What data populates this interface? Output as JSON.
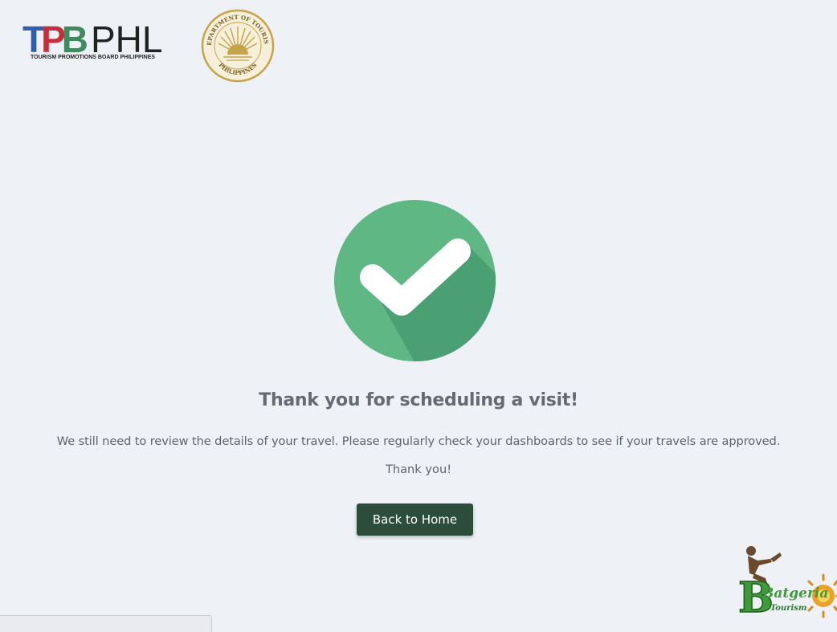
{
  "header": {
    "tpb_logo": {
      "mark_letters": [
        "T",
        "P",
        "B"
      ],
      "phl": "PHL",
      "subtitle": "TOURISM PROMOTIONS BOARD PHILIPPINES",
      "colors": {
        "t": "#2e5fb0",
        "p": "#c4303a",
        "b": "#3f8a5e"
      }
    },
    "dot_seal": {
      "top_text": "DEPARTMENT OF TOURISM",
      "bottom_text": "PHILIPPINES",
      "color": "#c7a34b"
    }
  },
  "main": {
    "success_icon": "check-circle-icon",
    "success_color": "#5fb883",
    "title": "Thank you for scheduling a visit!",
    "message": "We still need to review the details of your travel. Please regularly check your dashboards to see if your travels are approved.",
    "thanks": "Thank you!",
    "home_button_label": "Back to Home"
  },
  "watermark": {
    "logo_letter": "B",
    "text": "Batgeria",
    "subtitle": "Tourism"
  }
}
